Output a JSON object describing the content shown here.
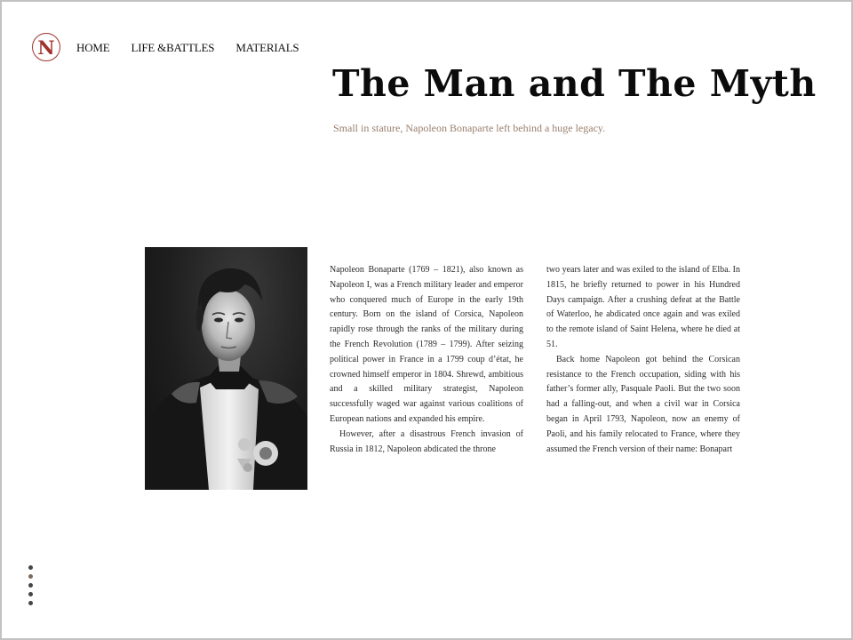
{
  "logo": {
    "letter": "N"
  },
  "nav": {
    "items": [
      {
        "label": "HOME"
      },
      {
        "label": "LIFE &BATTLES"
      },
      {
        "label": "MATERIALS"
      }
    ]
  },
  "hero": {
    "title": "The Man and The Myth",
    "subtitle": "Small in stature, Napoleon Bonaparte left behind a huge legacy."
  },
  "article": {
    "col1": [
      "Napoleon Bonaparte (1769 – 1821), also known as Napoleon I, was a French military leader and emperor who conquered much of Europe in the early 19th century. Born on the island of Corsica, Napoleon rapidly rose through the ranks of the military during the French Revolution (1789 – 1799). After seizing political power in France in a 1799 coup d’état, he crowned himself emperor in 1804. Shrewd, ambitious and a skilled military strategist, Napoleon successfully waged war against various coalitions of European nations and expanded his empire.",
      "However, after a disastrous French invasion of Russia in 1812, Napoleon abdicated the throne"
    ],
    "col2": [
      "two years later and was exiled to the island of Elba. In 1815, he briefly returned to power in his Hundred Days campaign. After a crushing defeat at the Battle of Waterloo, he abdicated once again and was exiled to the remote island of Saint Helena, where he died at 51.",
      "Back home Napoleon got behind the Corsican resistance to the French occupation, siding with his father’s former ally, Pasquale Paoli. But the two soon had a falling-out, and when a civil war in Corsica began in April 1793, Napoleon, now an enemy of Paoli, and his family relocated to France, where they assumed the French version of their name: Bonapart"
    ]
  },
  "pager": {
    "count": 5,
    "active_index": 1
  },
  "colors": {
    "accent": "#a0322c",
    "subtitle": "#9a7f6e",
    "frame": "#c2c2c2"
  }
}
